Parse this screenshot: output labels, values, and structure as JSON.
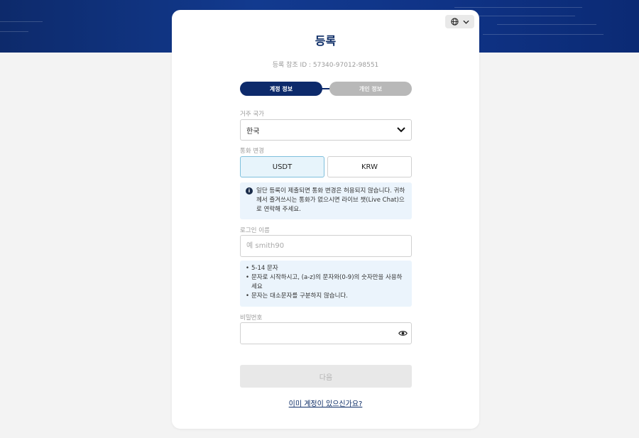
{
  "page": {
    "title": "등록",
    "reference": "등록 참조 ID : 57340-97012-98551"
  },
  "lang_button": {
    "icon": "globe-icon",
    "chevron": "chevron-down-icon"
  },
  "steps": [
    {
      "label": "계정 정보",
      "active": true
    },
    {
      "label": "개인 정보",
      "active": false
    }
  ],
  "country": {
    "label": "거주 국가",
    "value": "한국"
  },
  "currency": {
    "label": "통화 변경",
    "options": [
      "USDT",
      "KRW"
    ],
    "selected": "USDT",
    "notice": "일단 등록이 제출되면 통화 변경은 허용되지 않습니다. 귀하께서 즐겨쓰시는 통화가 없으시면 라이브 챗(Live Chat)으로 연락해 주세요."
  },
  "username": {
    "label": "로그인 이름",
    "placeholder": "예 smith90",
    "value": "",
    "hints": [
      "5-14 문자",
      "문자로 시작하시고, (a-z)의 문자와(0-9)의 숫자만을 사용하세요",
      "문자는 대소문자를 구분하지 않습니다."
    ]
  },
  "password": {
    "label": "비밀번호",
    "value": ""
  },
  "next_button": "다음",
  "login_link": "이미 계정이 있으신가요?",
  "colors": {
    "brand_navy": "#0d2a6b",
    "selected_bg": "#e7f4fb",
    "notice_bg": "#ebf4fc"
  }
}
